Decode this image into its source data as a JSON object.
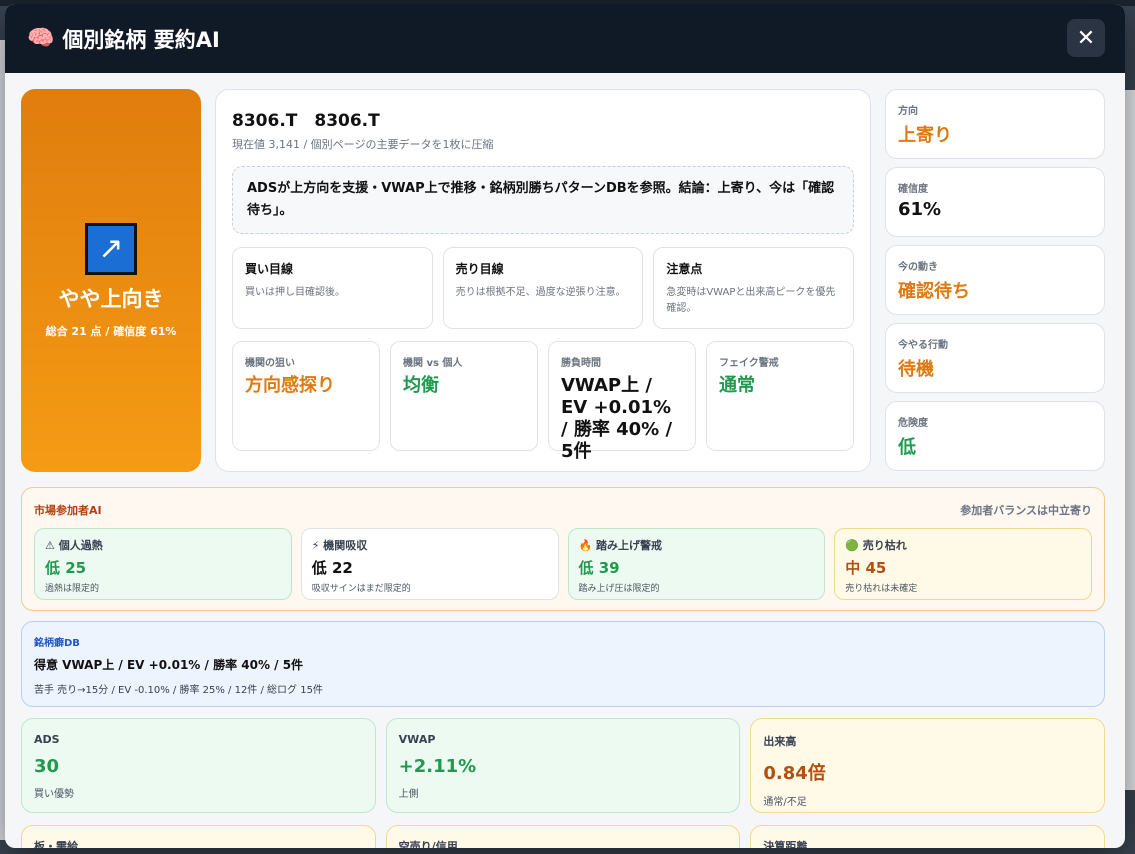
{
  "header": {
    "icon": "brain-icon",
    "title": "個別銘柄 要約AI",
    "close_label": "✕"
  },
  "hero": {
    "arrow": "↗",
    "label": "やや上向き",
    "sub": "総合 21 点 / 確信度 61%"
  },
  "main": {
    "ticker": "8306.T　8306.T",
    "subtitle": "現在値 3,141 / 個別ページの主要データを1枚に圧縮",
    "summary": "ADSが上方向を支援・VWAP上で推移・銘柄別勝ちパターンDBを参照。結論：上寄り、今は「確認待ち」。",
    "targets": [
      {
        "title": "買い目線",
        "text": "買いは押し目確認後。"
      },
      {
        "title": "売り目線",
        "text": "売りは根拠不足、過度な逆張り注意。"
      },
      {
        "title": "注意点",
        "text": "急変時はVWAPと出来高ピークを優先確認。"
      }
    ],
    "metrics": [
      {
        "label": "機関の狙い",
        "value": "方向感探り"
      },
      {
        "label": "機関 vs 個人",
        "value": "均衡"
      },
      {
        "label": "勝負時間",
        "value": "VWAP上 / EV +0.01% / 勝率 40% / 5件"
      },
      {
        "label": "フェイク警戒",
        "value": "通常"
      }
    ]
  },
  "side": [
    {
      "label": "方向",
      "value": "上寄り"
    },
    {
      "label": "確信度",
      "value": "61%"
    },
    {
      "label": "今の動き",
      "value": "確認待ち"
    },
    {
      "label": "今やる行動",
      "value": "待機"
    },
    {
      "label": "危険度",
      "value": "低"
    }
  ],
  "participants": {
    "title": "市場参加者AI",
    "note": "参加者バランスは中立寄り",
    "cards": [
      {
        "name": "⚠ 個人過熱",
        "value": "低 25",
        "desc": "過熱は限定的"
      },
      {
        "name": "⚡ 機関吸収",
        "value": "低 22",
        "desc": "吸収サインはまだ限定的"
      },
      {
        "name": "🔥 踏み上げ警戒",
        "value": "低 39",
        "desc": "踏み上げ圧は限定的"
      },
      {
        "name": "🟢 売り枯れ",
        "value": "中 45",
        "desc": "売り枯れは未確定"
      }
    ]
  },
  "habit": {
    "title": "銘柄癖DB",
    "good": "得意 VWAP上 / EV +0.01% / 勝率 40% / 5件",
    "bad": "苦手 売り→15分 / EV -0.10% / 勝率 25% / 12件 / 総ログ 15件"
  },
  "stats": [
    {
      "label": "ADS",
      "value": "30",
      "desc": "買い優勢"
    },
    {
      "label": "VWAP",
      "value": "+2.11%",
      "desc": "上側"
    },
    {
      "label": "出来高",
      "value": "0.84倍",
      "desc": "通常/不足"
    }
  ],
  "stats2": [
    {
      "label": "板・需給"
    },
    {
      "label": "空売り/信用"
    },
    {
      "label": "決算距離"
    }
  ]
}
